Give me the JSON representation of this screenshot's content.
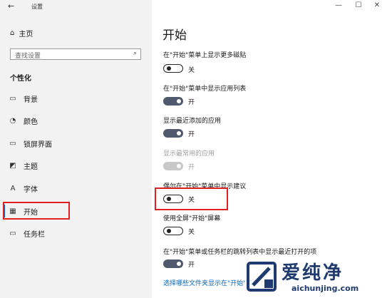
{
  "window": {
    "title": "设置",
    "back_icon": "←",
    "minimize": "—",
    "maximize": "☐",
    "close": "✕"
  },
  "sidebar": {
    "home_label": "主页",
    "search_placeholder": "查找设置",
    "section": "个性化",
    "items": [
      {
        "label": "背景",
        "icon": "▭"
      },
      {
        "label": "颜色",
        "icon": "◔"
      },
      {
        "label": "锁屏界面",
        "icon": "▭"
      },
      {
        "label": "主题",
        "icon": "◩"
      },
      {
        "label": "字体",
        "icon": "A"
      },
      {
        "label": "开始",
        "icon": "▦",
        "selected": true
      },
      {
        "label": "任务栏",
        "icon": "▭"
      }
    ]
  },
  "main": {
    "title": "开始",
    "settings": [
      {
        "label": "在\"开始\"菜单上显示更多磁贴",
        "state": "关",
        "on": false,
        "disabled": false
      },
      {
        "label": "在\"开始\"菜单中显示应用列表",
        "state": "开",
        "on": true,
        "disabled": false
      },
      {
        "label": "显示最近添加的应用",
        "state": "开",
        "on": true,
        "disabled": false
      },
      {
        "label": "显示最常用的应用",
        "state": "开",
        "on": true,
        "disabled": true
      },
      {
        "label": "偶尔在\"开始\"菜单中显示建议",
        "state": "关",
        "on": false,
        "disabled": false
      },
      {
        "label": "使用全屏\"开始\"屏幕",
        "state": "关",
        "on": false,
        "disabled": false
      },
      {
        "label": "在\"开始\"菜单或任务栏的跳转列表中显示最近打开的项",
        "state": "开",
        "on": true,
        "disabled": false
      }
    ],
    "link": "选择哪些文件夹显示在\"开始\"菜单上"
  },
  "watermark": {
    "title": "爱纯净",
    "url": "aichunjing.com",
    "color": "#1e3a6e"
  },
  "colors": {
    "accent": "#0067c0",
    "toggle_on": "#505a6e",
    "highlight": "#e02020"
  }
}
